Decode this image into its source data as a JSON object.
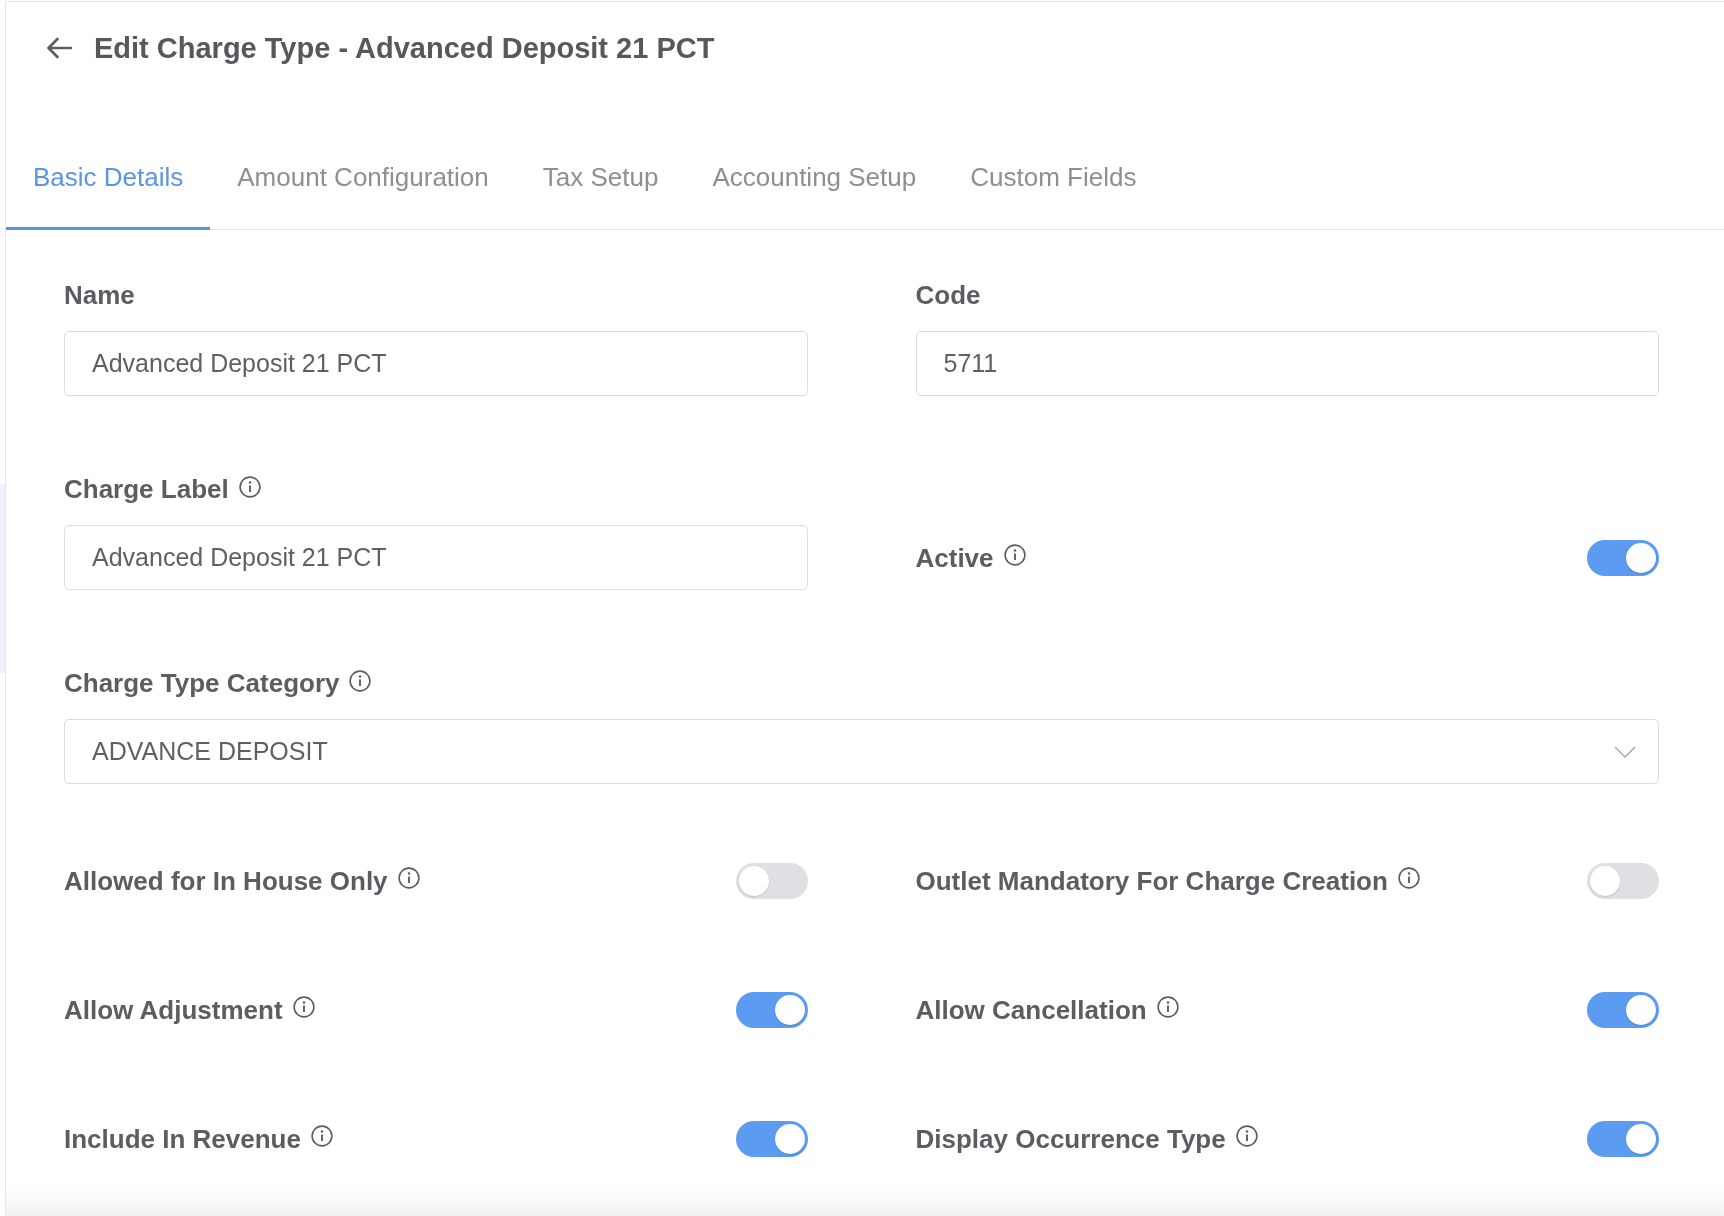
{
  "header": {
    "title": "Edit Charge Type - Advanced Deposit 21 PCT"
  },
  "tabs": [
    {
      "label": "Basic Details",
      "selected": true
    },
    {
      "label": "Amount Configuration",
      "selected": false
    },
    {
      "label": "Tax Setup",
      "selected": false
    },
    {
      "label": "Accounting Setup",
      "selected": false
    },
    {
      "label": "Custom Fields",
      "selected": false
    }
  ],
  "fields": [
    {
      "kind": "text",
      "label": "Name",
      "info": false,
      "value": "Advanced Deposit 21 PCT"
    },
    {
      "kind": "text",
      "label": "Code",
      "info": false,
      "value": "5711"
    },
    {
      "kind": "text",
      "label": "Charge Label",
      "info": true,
      "value": "Advanced Deposit 21 PCT"
    },
    {
      "kind": "switch",
      "label": "Active",
      "info": true,
      "on": true
    },
    {
      "kind": "select",
      "label": "Charge Type Category",
      "info": true,
      "value": "ADVANCE DEPOSIT"
    }
  ],
  "switches": [
    {
      "label": "Allowed for In House Only",
      "info": true,
      "on": false
    },
    {
      "label": "Outlet Mandatory For Charge Creation",
      "info": true,
      "on": false
    },
    {
      "label": "Allow Adjustment",
      "info": true,
      "on": true
    },
    {
      "label": "Allow Cancellation",
      "info": true,
      "on": true
    },
    {
      "label": "Include In Revenue",
      "info": true,
      "on": true
    },
    {
      "label": "Display Occurrence Type",
      "info": true,
      "on": true
    }
  ]
}
